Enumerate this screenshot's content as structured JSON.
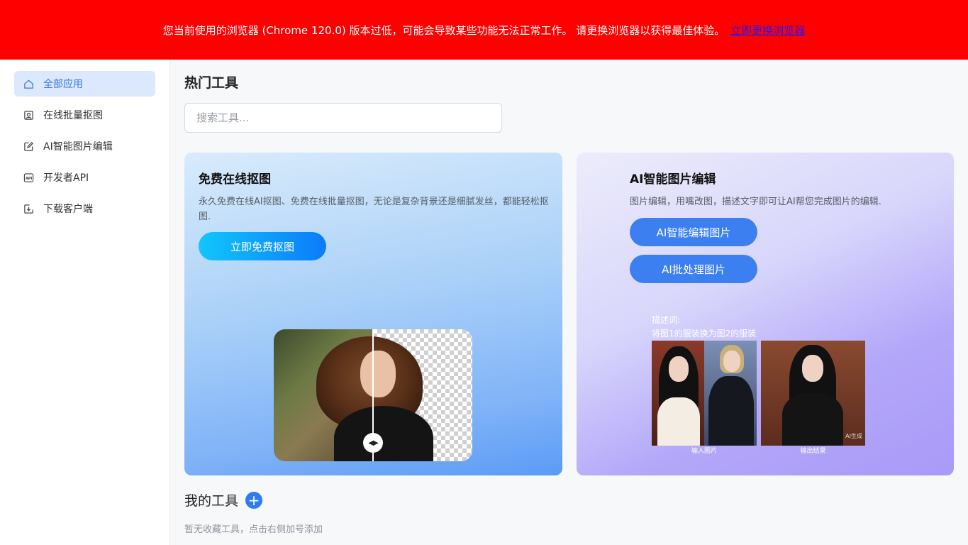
{
  "banner": {
    "message": "您当前使用的浏览器 (Chrome 120.0) 版本过低，可能会导致某些功能无法正常工作。 请更换浏览器以获得最佳体验。",
    "link_text": "立即更换浏览器"
  },
  "sidebar": {
    "items": [
      {
        "label": "全部应用",
        "icon": "home-icon",
        "active": true
      },
      {
        "label": "在线批量抠图",
        "icon": "portrait-icon",
        "active": false
      },
      {
        "label": "AI智能图片编辑",
        "icon": "edit-icon",
        "active": false
      },
      {
        "label": "开发者API",
        "icon": "api-icon",
        "active": false
      },
      {
        "label": "下载客户端",
        "icon": "download-icon",
        "active": false
      }
    ]
  },
  "main": {
    "hot_tools_title": "热门工具",
    "search_placeholder": "搜索工具...",
    "cards": [
      {
        "title": "免费在线抠图",
        "description": "永久免费在线AI抠图、免费在线批量抠图，无论是复杂背景还是细腻发丝，都能轻松抠图.",
        "button": "立即免费抠图"
      },
      {
        "title": "AI智能图片编辑",
        "description": "图片编辑，用嘴改图，描述文字即可让AI帮您完成图片的编辑.",
        "buttons": [
          "AI智能编辑图片",
          "AI批处理图片"
        ],
        "demo": {
          "caption_label": "描述词:",
          "caption_text": "将图1的服装换为图2的服装",
          "input_label": "输入图片",
          "output_label": "输出结果",
          "ai_tag": "AI生成"
        }
      }
    ],
    "my_tools_title": "我的工具",
    "add_symbol": "+",
    "empty_hint": "暂无收藏工具，点击右侧加号添加"
  },
  "colors": {
    "banner_bg": "#ff0000",
    "active_nav_bg": "#dbe8fd",
    "accent_blue": "#3b7ff0"
  }
}
